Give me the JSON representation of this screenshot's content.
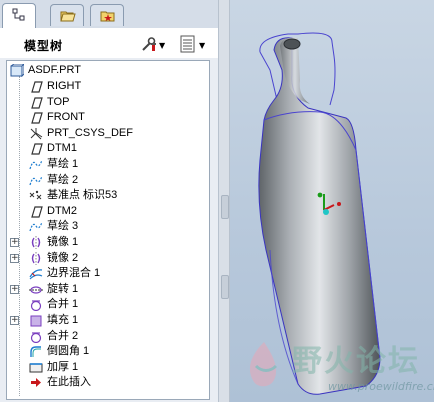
{
  "panel": {
    "title": "模型树",
    "tabs": [
      {
        "name": "model-tree-tab",
        "icon": "tree-icon",
        "active": true
      },
      {
        "name": "folder-tab",
        "icon": "folder-icon",
        "active": false
      },
      {
        "name": "favorites-tab",
        "icon": "star-folder-icon",
        "active": false
      }
    ],
    "tools": {
      "settings_icon": "settings-tools-icon",
      "show_icon": "list-display-icon"
    }
  },
  "tree": {
    "root": "ASDF.PRT",
    "items": [
      {
        "label": "RIGHT",
        "icon": "datum-plane-icon",
        "expand": false
      },
      {
        "label": "TOP",
        "icon": "datum-plane-icon",
        "expand": false
      },
      {
        "label": "FRONT",
        "icon": "datum-plane-icon",
        "expand": false
      },
      {
        "label": "PRT_CSYS_DEF",
        "icon": "csys-icon",
        "expand": false
      },
      {
        "label": "DTM1",
        "icon": "datum-plane-icon",
        "expand": false
      },
      {
        "label": "草绘 1",
        "icon": "sketch-icon",
        "expand": false
      },
      {
        "label": "草绘 2",
        "icon": "sketch-icon",
        "expand": false
      },
      {
        "label": "基准点 标识53",
        "icon": "datum-point-icon",
        "expand": false
      },
      {
        "label": "DTM2",
        "icon": "datum-plane-icon",
        "expand": false
      },
      {
        "label": "草绘 3",
        "icon": "sketch-icon",
        "expand": false
      },
      {
        "label": "镜像 1",
        "icon": "mirror-icon",
        "expand": true
      },
      {
        "label": "镜像 2",
        "icon": "mirror-icon",
        "expand": true
      },
      {
        "label": "边界混合 1",
        "icon": "boundary-blend-icon",
        "expand": false
      },
      {
        "label": "旋转 1",
        "icon": "revolve-icon",
        "expand": true
      },
      {
        "label": "合并 1",
        "icon": "merge-icon",
        "expand": false
      },
      {
        "label": "填充 1",
        "icon": "fill-icon",
        "expand": true
      },
      {
        "label": "合并 2",
        "icon": "merge-icon",
        "expand": false
      },
      {
        "label": "倒圆角 1",
        "icon": "round-icon",
        "expand": false
      },
      {
        "label": "加厚 1",
        "icon": "thicken-icon",
        "expand": false
      },
      {
        "label": "在此插入",
        "icon": "insert-here-arrow-icon",
        "expand": false
      }
    ]
  },
  "watermark": {
    "title": "野火论坛",
    "url": "www.proewildfire.cn"
  },
  "colors": {
    "accent": "#1a4fd6",
    "sketch": "#1c7ccf",
    "insert_arrow": "#c8171b",
    "surface_edge": "#5b55d8"
  }
}
